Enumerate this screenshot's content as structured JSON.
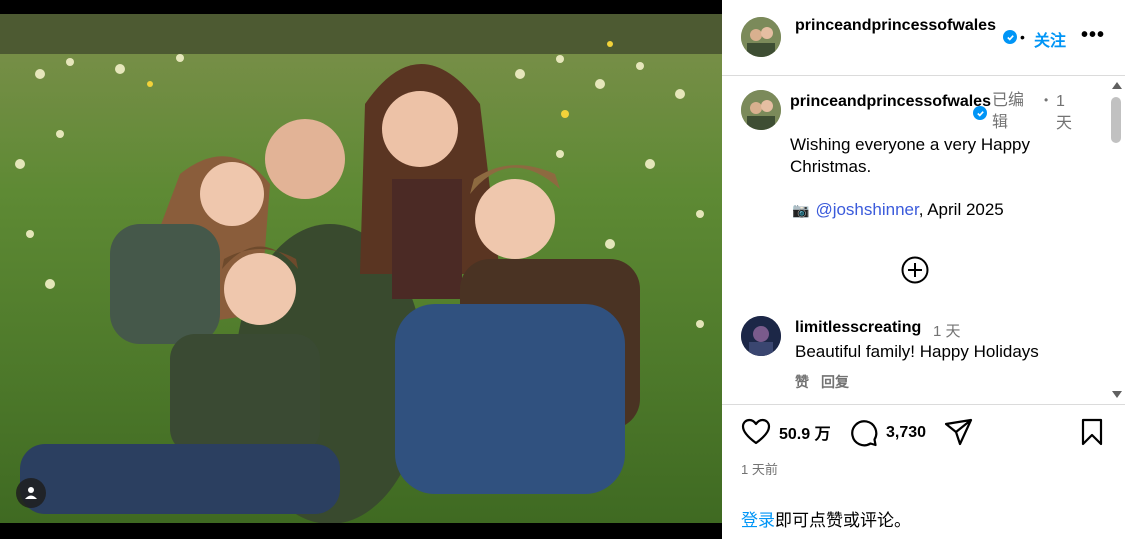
{
  "post": {
    "username": "princeandprincessofwales",
    "follow_label": "关注",
    "more_label": "•••",
    "dot": "•"
  },
  "caption": {
    "username": "princeandprincessofwales",
    "edited_label": "已编辑",
    "time": "1 天",
    "text": "Wishing everyone a very Happy Christmas.",
    "credit_icon": "camera-emoji",
    "credit_mention": "@joshshinner",
    "credit_rest": ", April 2025"
  },
  "load_more_icon": "plus-circle-icon",
  "comment": {
    "username": "limitlesscreating",
    "time": "1 天",
    "text": "Beautiful family! Happy Holidays",
    "like_label": "赞",
    "reply_label": "回复"
  },
  "stats": {
    "likes": "50.9 万",
    "comments": "3,730"
  },
  "posted_ago": "1 天前",
  "login_prompt": {
    "link": "登录",
    "rest": "即可点赞或评论。"
  },
  "colors": {
    "accent": "#0095f6",
    "secondary_text": "#737373",
    "border": "#dbdbdb"
  }
}
